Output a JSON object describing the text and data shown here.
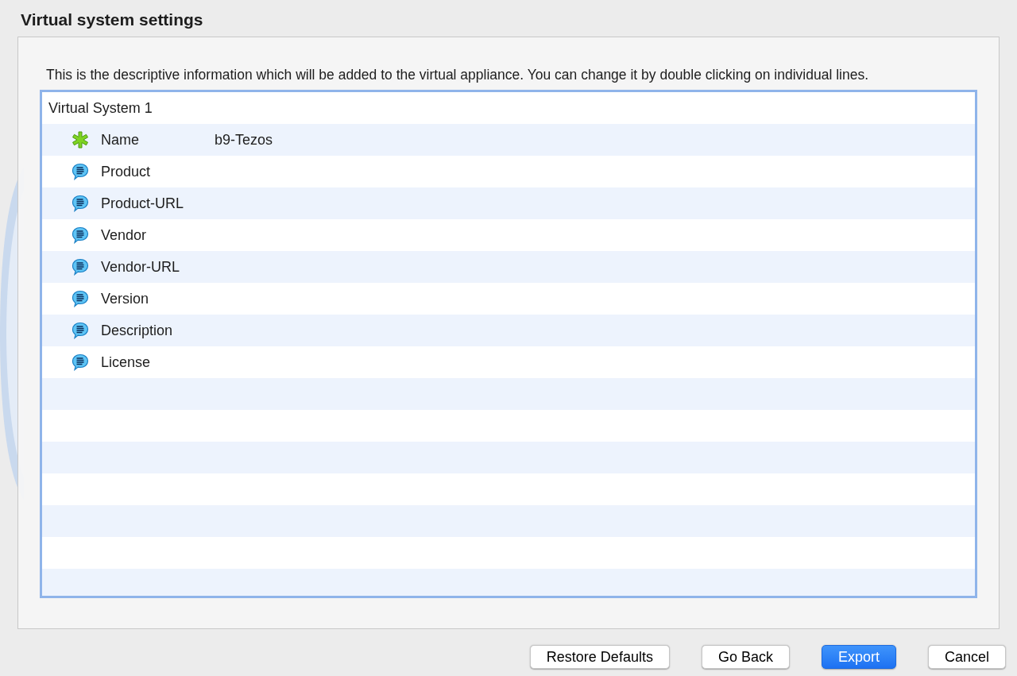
{
  "title": "Virtual system settings",
  "description": "This is the descriptive information which will be added to the virtual appliance. You can change it by double clicking on individual lines.",
  "tree": {
    "system": "Virtual System 1",
    "items": [
      {
        "kind": "name",
        "label": "Name",
        "value": "b9-Tezos"
      },
      {
        "kind": "text",
        "label": "Product"
      },
      {
        "kind": "text",
        "label": "Product-URL"
      },
      {
        "kind": "text",
        "label": "Vendor"
      },
      {
        "kind": "text",
        "label": "Vendor-URL"
      },
      {
        "kind": "text",
        "label": "Version"
      },
      {
        "kind": "text",
        "label": "Description"
      },
      {
        "kind": "text",
        "label": "License"
      }
    ]
  },
  "buttons": [
    {
      "label": "Restore Defaults",
      "default": false
    },
    {
      "label": "Go Back",
      "default": false
    },
    {
      "label": "Export",
      "default": true
    },
    {
      "label": "Cancel",
      "default": false
    }
  ]
}
